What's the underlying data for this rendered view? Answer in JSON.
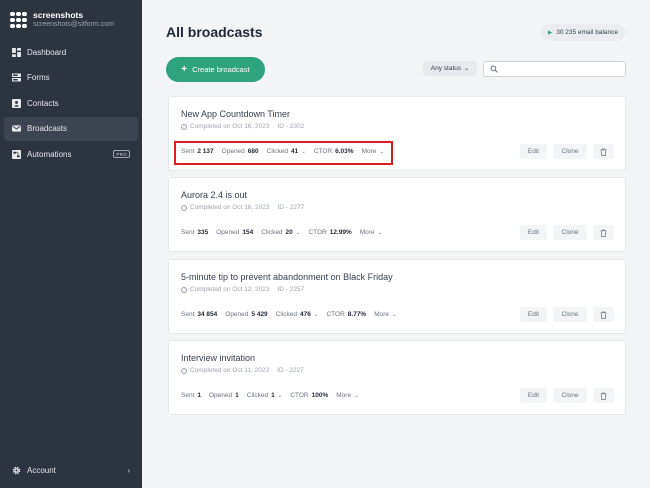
{
  "app": {
    "workspace_name": "screenshots",
    "workspace_subtitle": "screenshots@sitform.com"
  },
  "sidebar": {
    "items": [
      {
        "label": "Dashboard",
        "icon": "dashboard-icon",
        "active": false
      },
      {
        "label": "Forms",
        "icon": "forms-icon",
        "active": false
      },
      {
        "label": "Contacts",
        "icon": "contacts-icon",
        "active": false
      },
      {
        "label": "Broadcasts",
        "icon": "mail-icon",
        "active": true
      },
      {
        "label": "Automations",
        "icon": "automations-icon",
        "active": false,
        "badge": "PRO"
      }
    ],
    "account_label": "Account",
    "account_chevron": "›"
  },
  "header": {
    "title": "All broadcasts",
    "balance": "30 235 email balance",
    "create_button": "Create broadcast",
    "status_filter": "Any status",
    "search_placeholder": ""
  },
  "labels": {
    "sent": "Sent",
    "opened": "Opened",
    "clicked": "Clicked",
    "ctor": "CTOR",
    "more": "More",
    "edit": "Edit",
    "clone": "Clone"
  },
  "broadcasts": [
    {
      "title": "New App Countdown Timer",
      "completed": "Completed on Oct 16, 2023",
      "id": "ID - 2302",
      "sent": "2 137",
      "opened": "680",
      "clicked": "41",
      "ctor": "6.03%"
    },
    {
      "title": "Aurora 2.4 is out",
      "completed": "Completed on Oct 16, 2023",
      "id": "ID - 2277",
      "sent": "335",
      "opened": "154",
      "clicked": "20",
      "ctor": "12.99%"
    },
    {
      "title": "5-minute tip to prevent abandonment on Black Friday",
      "completed": "Completed on Oct 12, 2023",
      "id": "ID - 2257",
      "sent": "34 854",
      "opened": "5 429",
      "clicked": "476",
      "ctor": "8.77%"
    },
    {
      "title": "Interview invitation",
      "completed": "Completed on Oct 11, 2023",
      "id": "ID - 2227",
      "sent": "1",
      "opened": "1",
      "clicked": "1",
      "ctor": "100%"
    }
  ],
  "colors": {
    "sidebar_bg": "#2c3440",
    "accent_green": "#2fa37c",
    "highlight_red": "#dc1f26"
  }
}
